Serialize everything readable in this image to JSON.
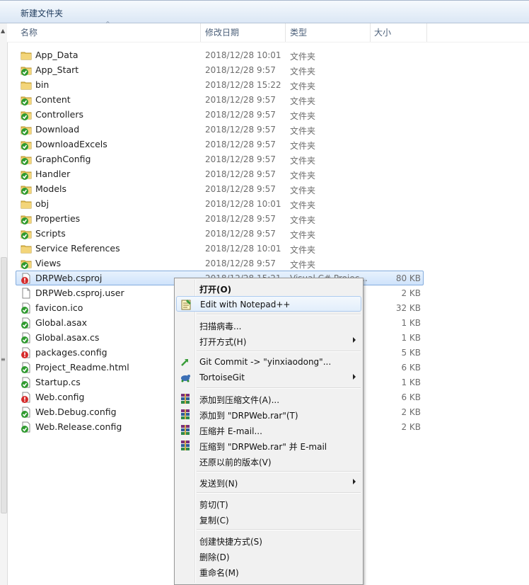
{
  "toolbar": {
    "new_folder": "新建文件夹"
  },
  "columns": {
    "name": "名称",
    "date": "修改日期",
    "type": "类型",
    "size": "大小"
  },
  "files": [
    {
      "name": "App_Data",
      "date": "2018/12/28 10:01",
      "type": "文件夹",
      "size": "",
      "icon": "folder-icon"
    },
    {
      "name": "App_Start",
      "date": "2018/12/28 9:57",
      "type": "文件夹",
      "size": "",
      "icon": "folder-git-icon"
    },
    {
      "name": "bin",
      "date": "2018/12/28 15:22",
      "type": "文件夹",
      "size": "",
      "icon": "folder-icon"
    },
    {
      "name": "Content",
      "date": "2018/12/28 9:57",
      "type": "文件夹",
      "size": "",
      "icon": "folder-git-icon"
    },
    {
      "name": "Controllers",
      "date": "2018/12/28 9:57",
      "type": "文件夹",
      "size": "",
      "icon": "folder-git-icon"
    },
    {
      "name": "Download",
      "date": "2018/12/28 9:57",
      "type": "文件夹",
      "size": "",
      "icon": "folder-git-icon"
    },
    {
      "name": "DownloadExcels",
      "date": "2018/12/28 9:57",
      "type": "文件夹",
      "size": "",
      "icon": "folder-git-icon"
    },
    {
      "name": "GraphConfig",
      "date": "2018/12/28 9:57",
      "type": "文件夹",
      "size": "",
      "icon": "folder-git-icon"
    },
    {
      "name": "Handler",
      "date": "2018/12/28 9:57",
      "type": "文件夹",
      "size": "",
      "icon": "folder-git-icon"
    },
    {
      "name": "Models",
      "date": "2018/12/28 9:57",
      "type": "文件夹",
      "size": "",
      "icon": "folder-git-icon"
    },
    {
      "name": "obj",
      "date": "2018/12/28 10:01",
      "type": "文件夹",
      "size": "",
      "icon": "folder-icon"
    },
    {
      "name": "Properties",
      "date": "2018/12/28 9:57",
      "type": "文件夹",
      "size": "",
      "icon": "folder-git-icon"
    },
    {
      "name": "Scripts",
      "date": "2018/12/28 9:57",
      "type": "文件夹",
      "size": "",
      "icon": "folder-git-icon"
    },
    {
      "name": "Service References",
      "date": "2018/12/28 10:01",
      "type": "文件夹",
      "size": "",
      "icon": "folder-icon"
    },
    {
      "name": "Views",
      "date": "2018/12/28 9:57",
      "type": "文件夹",
      "size": "",
      "icon": "folder-git-icon"
    },
    {
      "name": "DRPWeb.csproj",
      "date": "2018/12/28 15:21",
      "type": "Visual C# Projec...",
      "size": "80 KB",
      "icon": "file-modified-icon"
    },
    {
      "name": "DRPWeb.csproj.user",
      "date": "",
      "type": "",
      "size": "2 KB",
      "icon": "file-icon"
    },
    {
      "name": "favicon.ico",
      "date": "",
      "type": "",
      "size": "32 KB",
      "icon": "file-git-icon"
    },
    {
      "name": "Global.asax",
      "date": "",
      "type": "",
      "size": "1 KB",
      "icon": "file-git-icon"
    },
    {
      "name": "Global.asax.cs",
      "date": "",
      "type": "",
      "size": "1 KB",
      "icon": "file-git-icon"
    },
    {
      "name": "packages.config",
      "date": "",
      "type": "",
      "size": "5 KB",
      "icon": "file-modified-icon"
    },
    {
      "name": "Project_Readme.html",
      "date": "",
      "type": "",
      "size": "6 KB",
      "icon": "file-git-icon"
    },
    {
      "name": "Startup.cs",
      "date": "",
      "type": "",
      "size": "1 KB",
      "icon": "file-git-icon"
    },
    {
      "name": "Web.config",
      "date": "",
      "type": "",
      "size": "6 KB",
      "icon": "file-modified-icon"
    },
    {
      "name": "Web.Debug.config",
      "date": "",
      "type": "",
      "size": "2 KB",
      "icon": "file-git-icon"
    },
    {
      "name": "Web.Release.config",
      "date": "",
      "type": "",
      "size": "2 KB",
      "icon": "file-git-icon"
    }
  ],
  "selected_index": 15,
  "menu": {
    "open": "打开(O)",
    "notepad": "Edit with Notepad++",
    "scan": "扫描病毒...",
    "open_with": "打开方式(H)",
    "git_commit": "Git Commit -> \"yinxiaodong\"...",
    "tortoise": "TortoiseGit",
    "add_archive": "添加到压缩文件(A)...",
    "add_rar": "添加到 \"DRPWeb.rar\"(T)",
    "zip_email": "压缩并 E-mail...",
    "zip_rar_email": "压缩到 \"DRPWeb.rar\" 并 E-mail",
    "restore": "还原以前的版本(V)",
    "send_to": "发送到(N)",
    "cut": "剪切(T)",
    "copy": "复制(C)",
    "shortcut": "创建快捷方式(S)",
    "delete": "删除(D)",
    "rename": "重命名(M)"
  }
}
